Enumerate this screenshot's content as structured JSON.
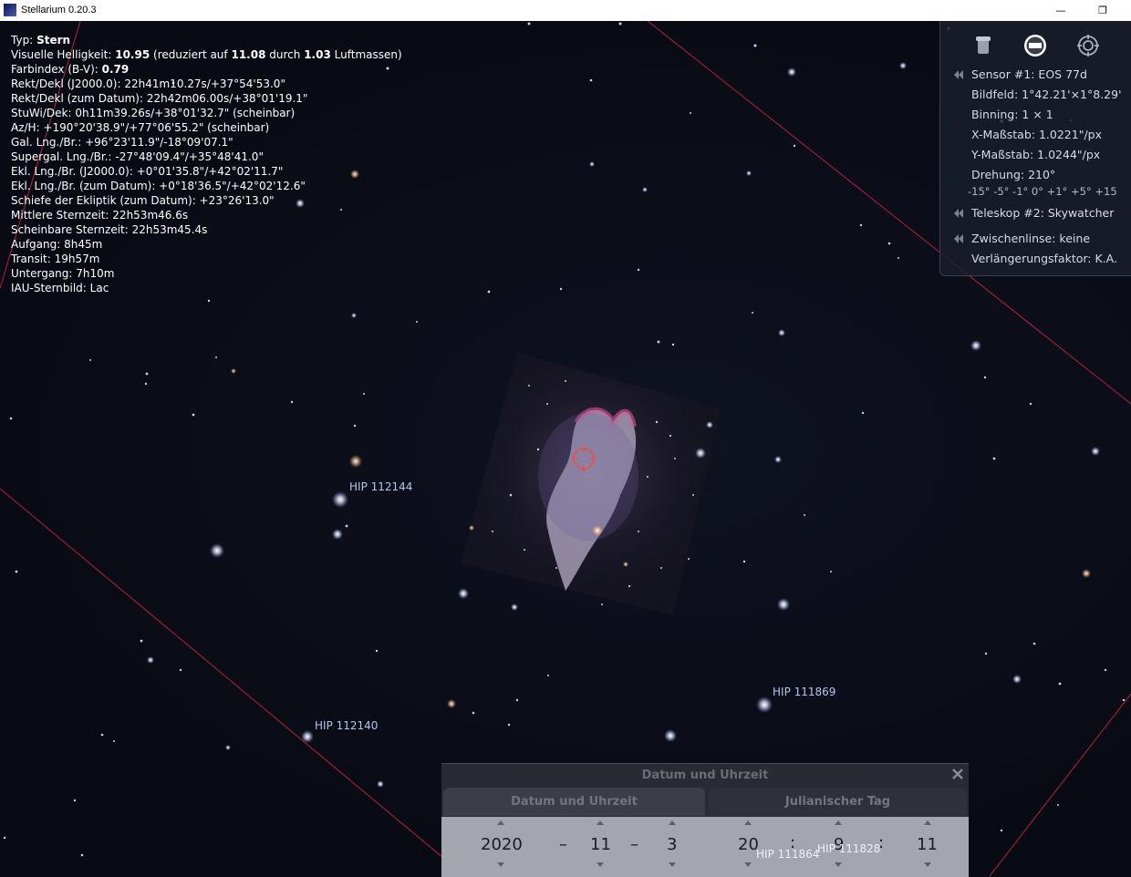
{
  "window": {
    "title": "Stellarium 0.20.3",
    "minimize_glyph": "—",
    "restore_glyph": "❐"
  },
  "info": {
    "typ_label": "Typ:",
    "typ_value": "Stern",
    "mag_prefix": "Visuelle Helligkeit:",
    "mag_value": "10.95",
    "mag_reduced_text": "(reduziert auf",
    "mag_reduced_value": "11.08",
    "mag_durch": "durch",
    "mag_airmass_value": "1.03",
    "mag_airmass_text": "Luftmassen)",
    "color_label": "Farbindex (B-V):",
    "color_value": "0.79",
    "lines": [
      "Rekt/Dekl (J2000.0): 22h41m10.27s/+37°54'53.0\"",
      "Rekt/Dekl (zum Datum): 22h42m06.00s/+38°01'19.1\"",
      "StuWi/Dek: 0h11m39.26s/+38°01'32.7\" (scheinbar)",
      "Az/H: +190°20'38.9\"/+77°06'55.2\" (scheinbar)",
      "Gal. Lng./Br.: +96°23'11.9\"/-18°09'07.1\"",
      "Supergal. Lng./Br.: -27°48'09.4\"/+35°48'41.0\"",
      "Ekl. Lng./Br. (J2000.0): +0°01'35.8\"/+42°02'11.7\"",
      "Ekl. Lng./Br. (zum Datum): +0°18'36.5\"/+42°02'12.6\"",
      "Schiefe der Ekliptik (zum Datum): +23°26'13.0\"",
      "Mittlere Sternzeit: 22h53m46.6s",
      "Scheinbare Sternzeit: 22h53m45.4s",
      "Aufgang: 8h45m",
      "Transit: 19h57m",
      "Untergang: 7h10m",
      "IAU-Sternbild: Lac"
    ]
  },
  "ocular": {
    "icons": [
      "telescope-icon",
      "ccd-sensor-icon",
      "crosshair-icon"
    ],
    "sensor": "Sensor #1: EOS 77d",
    "bildfeld": "Bildfeld: 1°42.21'×1°8.29'",
    "binning": "Binning: 1 × 1",
    "x_scale": "X-Maßstab: 1.0221\"/px",
    "y_scale": "Y-Maßstab: 1.0244\"/px",
    "rotation": "Drehung: 210°",
    "fov_scale": "-15° -5° -1° 0° +1° +5° +15",
    "telescope": "Teleskop #2: Skywatcher",
    "lens": "Zwischenlinse: keine",
    "extension": "Verlängerungsfaktor: K.A."
  },
  "star_labels": [
    {
      "name": "HIP 112144"
    },
    {
      "name": "HIP 112140"
    },
    {
      "name": "HIP 111869"
    },
    {
      "name": "HIP 111864"
    },
    {
      "name": "HIP 111828"
    }
  ],
  "date_dialog": {
    "title": "Datum und Uhrzeit",
    "tab_date": "Datum und Uhrzeit",
    "tab_jd": "Julianischer Tag",
    "year": "2020",
    "month": "11",
    "day": "3",
    "hour": "20",
    "minute": "9",
    "second": "11",
    "date_sep": "–",
    "time_sep": ":"
  },
  "colors": {
    "sky_bg": "#0b0d17",
    "boundary_line": "#b2213a",
    "label_blue": "#b8c4ee",
    "reticle": "#e8504a"
  }
}
